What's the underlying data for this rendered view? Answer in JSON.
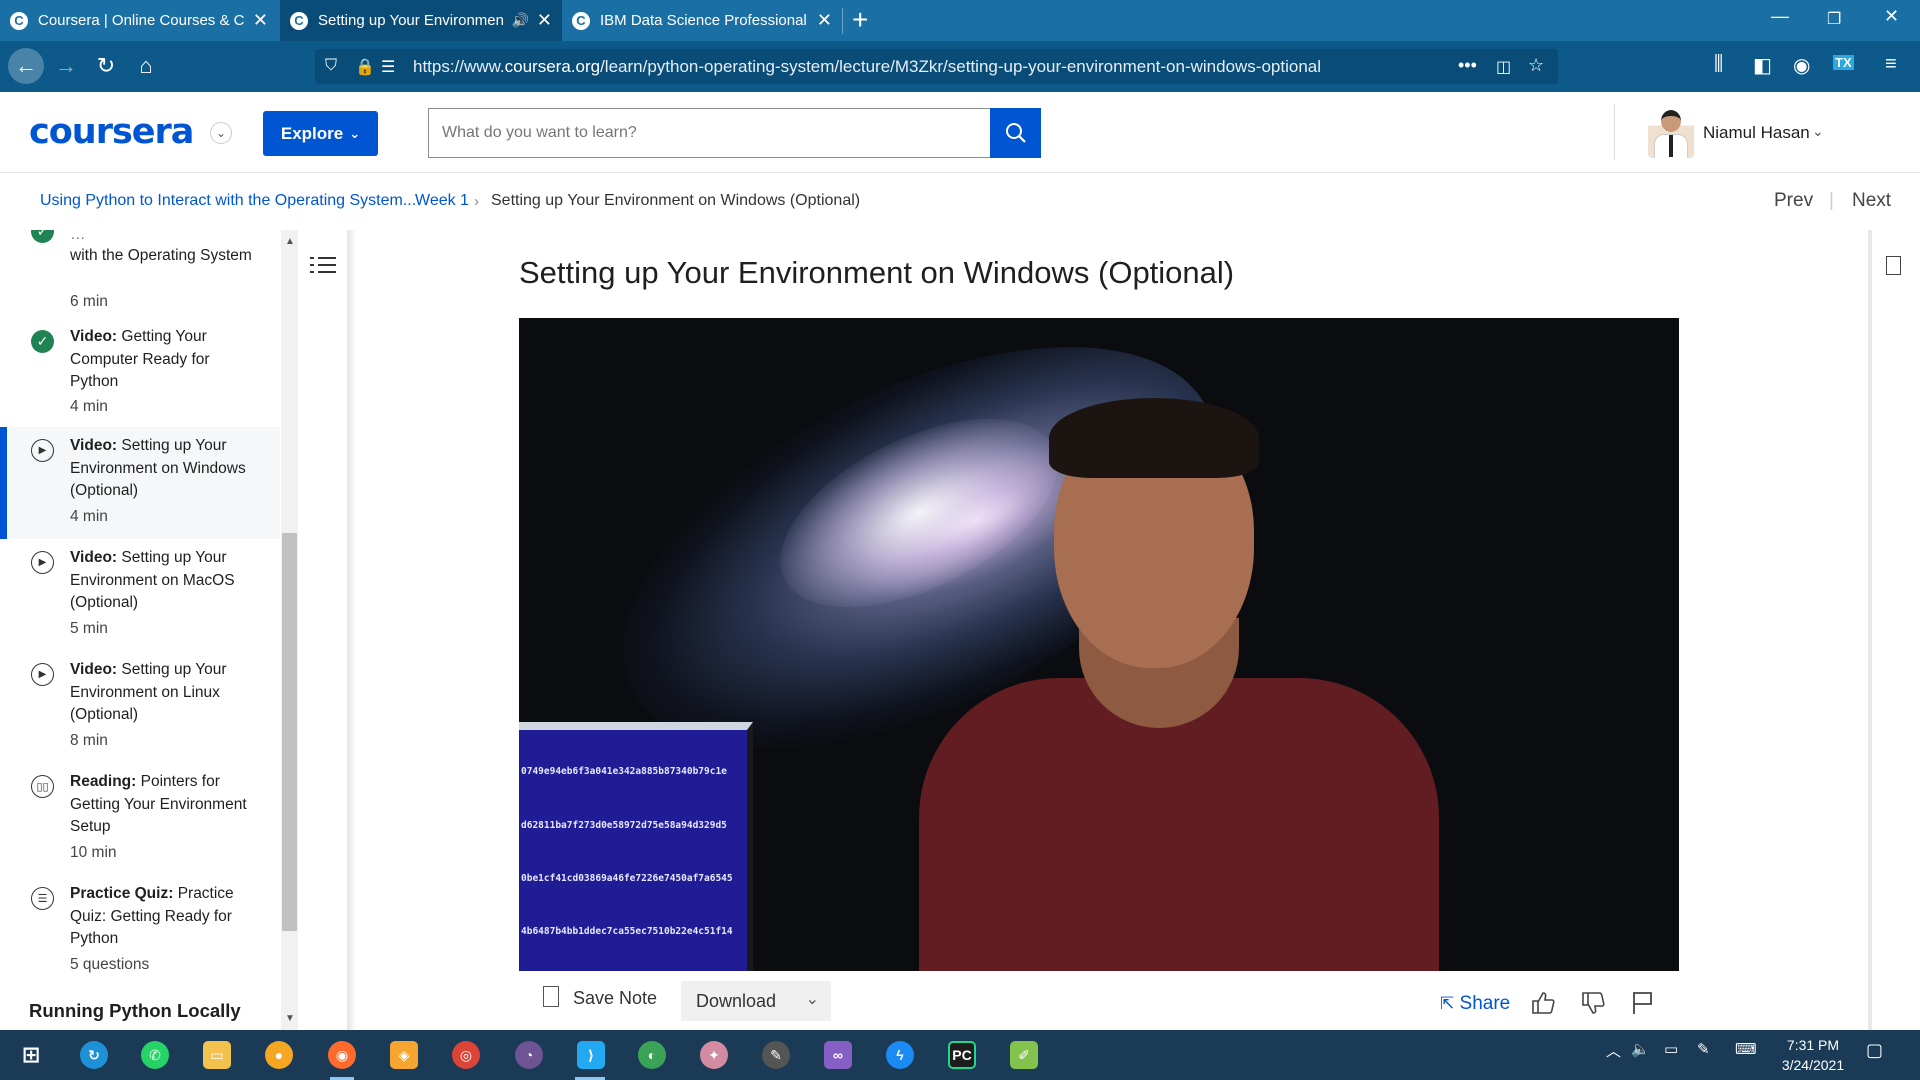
{
  "browser": {
    "tabs": [
      {
        "title": "Coursera | Online Courses & Cr",
        "favicon": "C"
      },
      {
        "title": "Setting up Your Environmen",
        "favicon": "C",
        "audio_icon": "speaker-icon"
      },
      {
        "title": "IBM Data Science Professional",
        "favicon": "C"
      }
    ],
    "url_prefix": "https://www.",
    "url_domain": "coursera.org",
    "url_path": "/learn/python-operating-system/lecture/M3Zkr/setting-up-your-environment-on-windows-optional"
  },
  "header": {
    "logo": "coursera",
    "explore_label": "Explore",
    "search_placeholder": "What do you want to learn?",
    "user_name": "Niamul Hasan"
  },
  "breadcrumb": {
    "course": "Using Python to Interact with the Operating System...",
    "week": "Week 1",
    "current": "Setting up Your Environment on Windows (Optional)",
    "prev": "Prev",
    "next": "Next"
  },
  "sidebar": {
    "items": [
      {
        "type_label": "",
        "title": "with the Operating System",
        "meta": "6 min",
        "status": "completed",
        "icon": "check-icon"
      },
      {
        "type_label": "Video:",
        "title": "Getting Your Computer Ready for Python",
        "meta": "4 min",
        "status": "completed",
        "icon": "check-icon"
      },
      {
        "type_label": "Video:",
        "title": "Setting up Your Environment on Windows (Optional)",
        "meta": "4 min",
        "status": "active",
        "icon": "play-icon"
      },
      {
        "type_label": "Video:",
        "title": "Setting up Your Environment on MacOS (Optional)",
        "meta": "5 min",
        "status": "todo",
        "icon": "play-icon"
      },
      {
        "type_label": "Video:",
        "title": "Setting up Your Environment on Linux (Optional)",
        "meta": "8 min",
        "status": "todo",
        "icon": "play-icon"
      },
      {
        "type_label": "Reading:",
        "title": "Pointers for Getting Your Environment Setup",
        "meta": "10 min",
        "status": "todo",
        "icon": "book-icon"
      },
      {
        "type_label": "Practice Quiz:",
        "title": "Practice Quiz: Getting Ready for Python",
        "meta": "5 questions",
        "status": "todo",
        "icon": "quiz-icon"
      }
    ],
    "section_heading": "Running Python Locally"
  },
  "lecture": {
    "title": "Setting up Your Environment on Windows (Optional)",
    "screen_hashes": [
      "0749e94eb6f3a041e342a885b87340b79c1e",
      "d62811ba7f273d0e58972d75e58a94d329d5",
      "0be1cf41cd03869a46fe7226e7450af7a6545",
      "4b6487b4bb1ddec7ca55ec7510b22e4c51f14"
    ]
  },
  "toolbar": {
    "save_note": "Save Note",
    "download": "Download",
    "share": "Share"
  },
  "taskbar": {
    "time": "7:31 PM",
    "date": "3/24/2021"
  },
  "colors": {
    "brand": "#0056d2",
    "tabbar": "#1a70a4",
    "completed": "#1f8354",
    "taskbar": "#1a3a56"
  }
}
